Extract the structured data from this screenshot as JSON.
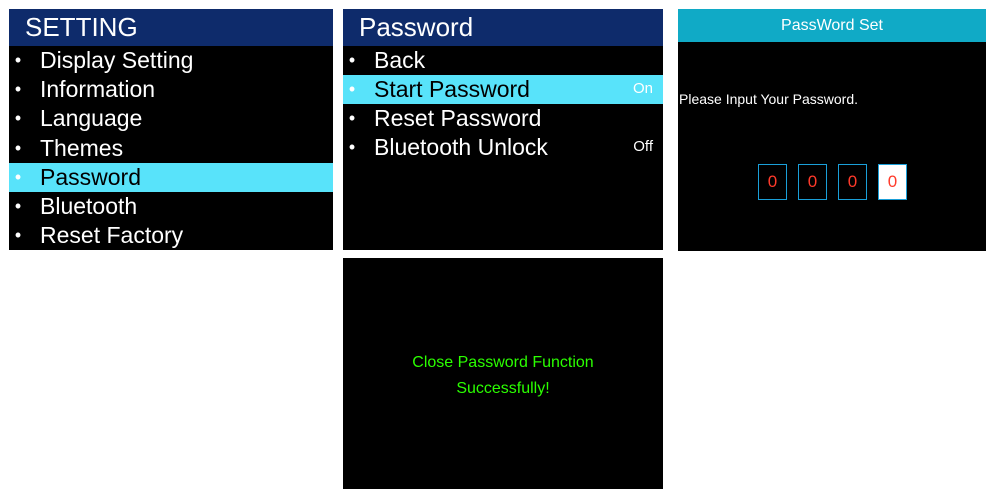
{
  "setting_screen": {
    "title": "SETTING",
    "items": [
      {
        "label": "Display Setting"
      },
      {
        "label": "Information"
      },
      {
        "label": "Language"
      },
      {
        "label": "Themes"
      },
      {
        "label": "Password",
        "selected": true
      },
      {
        "label": "Bluetooth"
      },
      {
        "label": "Reset Factory"
      }
    ],
    "bullet": "•"
  },
  "password_screen": {
    "title": "Password",
    "items": [
      {
        "label": "Back",
        "state": ""
      },
      {
        "label": "Start Password",
        "state": "On",
        "selected": true
      },
      {
        "label": "Reset Password",
        "state": ""
      },
      {
        "label": "Bluetooth Unlock",
        "state": "Off"
      }
    ],
    "bullet": "•"
  },
  "password_set_screen": {
    "title": "PassWord Set",
    "prompt": "Please Input Your Password.",
    "digits": [
      "0",
      "0",
      "0",
      "0"
    ],
    "active_digit": 3
  },
  "close_screen": {
    "line1": "Close Password Function",
    "line2": "Successfully!"
  },
  "colors": {
    "menu_header_bg": "#0e2b6b",
    "highlight_bg": "#58e3fa",
    "pw_header_bg": "#10aac6",
    "digit_color": "#ff3a2a",
    "success_color": "#2bff00"
  }
}
